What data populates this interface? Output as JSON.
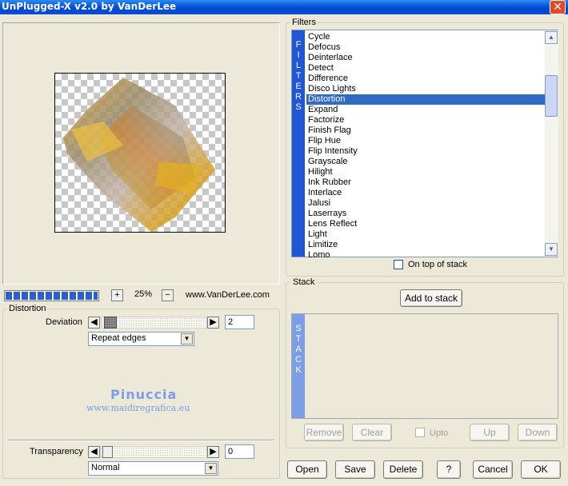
{
  "window": {
    "title": "UnPlugged-X v2.0 by VanDerLee"
  },
  "preview": {
    "zoom": "25%",
    "plus_label": "+",
    "minus_label": "−",
    "website": "www.VanDerLee.com",
    "progress": 1.0
  },
  "distortion": {
    "group_label": "Distortion",
    "deviation_label": "Deviation",
    "deviation_value": "2",
    "edge_mode": "Repeat edges"
  },
  "watermark": {
    "name": "Pinuccia",
    "url": "www.maidiregrafica.eu"
  },
  "transparency": {
    "label": "Transparency",
    "value": "0",
    "blend_mode": "Normal"
  },
  "filters": {
    "group_label": "Filters",
    "side_letters": [
      "F",
      "I",
      "L",
      "T",
      "E",
      "R",
      "S"
    ],
    "items": [
      "Cycle",
      "Defocus",
      "Deinterlace",
      "Detect",
      "Difference",
      "Disco Lights",
      "Distortion",
      "Expand",
      "Factorize",
      "Finish Flag",
      "Flip Hue",
      "Flip Intensity",
      "Grayscale",
      "Hilight",
      "Ink Rubber",
      "Interlace",
      "Jalusi",
      "Laserrays",
      "Lens Reflect",
      "Light",
      "Limitize",
      "Lomo"
    ],
    "selected": "Distortion",
    "on_top_label": "On top of stack"
  },
  "stack": {
    "group_label": "Stack",
    "add_label": "Add to stack",
    "side_letters": [
      "S",
      "T",
      "A",
      "C",
      "K"
    ],
    "remove_label": "Remove",
    "clear_label": "Clear",
    "upto_label": "Upto",
    "up_label": "Up",
    "down_label": "Down"
  },
  "footer": {
    "open_label": "Open",
    "save_label": "Save",
    "delete_label": "Delete",
    "help_label": "?",
    "cancel_label": "Cancel",
    "ok_label": "OK"
  },
  "colors": {
    "title_bar": "#0a5ae0",
    "selection": "#316ac5",
    "filters_bar": "#2055d5",
    "stack_bar": "#7b9ee6"
  },
  "icons": [
    "close-icon",
    "scroll-up-icon",
    "scroll-down-icon",
    "arrow-left-icon",
    "arrow-right-icon",
    "chevron-down-icon"
  ]
}
